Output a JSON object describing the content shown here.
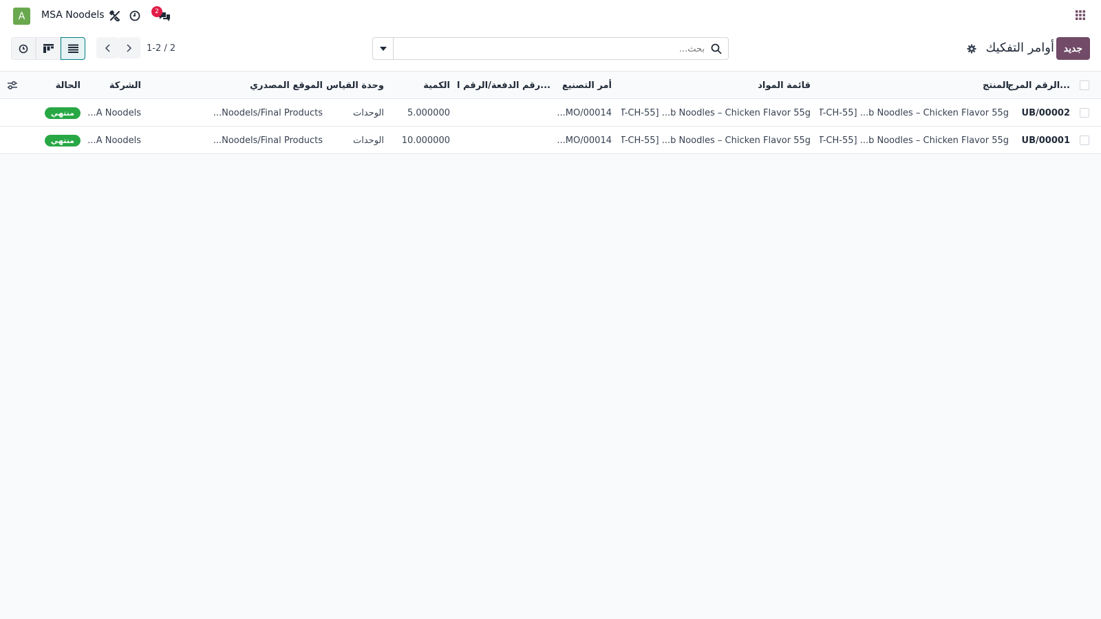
{
  "navbar": {
    "avatar_letter": "A",
    "company": "MSA Noodels",
    "chat_badge": "2",
    "icons": [
      "tools-icon",
      "clock-icon",
      "chat-icon",
      "apps-grid-icon"
    ]
  },
  "control": {
    "new_label": "جديد",
    "title": "أوامر التفكيك",
    "search_placeholder": "بحث...",
    "pager": "1-2 / 2"
  },
  "table": {
    "headers": {
      "ref": "الرقم المرج...",
      "product": "المنتج",
      "bom": "قائمة المواد",
      "mo": "أمر التصنيع",
      "lot": "رقم الدفعة/الرقم التس...",
      "qty": "الكمية",
      "uom": "وحدة القياس",
      "location": "الموقع المصدري",
      "company": "الشركة",
      "state": "الحالة"
    },
    "rows": [
      {
        "ref": "UB/00002",
        "product": "[AT-CH-55] ...b Noodles – Chicken Flavor 55g",
        "bom": "[AT-CH-55] ...b Noodles – Chicken Flavor 55g",
        "mo": "...MO/00014",
        "lot": "",
        "qty": "5.000000",
        "uom": "الوحدات",
        "location": "...Noodels/Final Products",
        "company": "...A Noodels",
        "state": "منتهي"
      },
      {
        "ref": "UB/00001",
        "product": "[AT-CH-55] ...b Noodles – Chicken Flavor 55g",
        "bom": "[AT-CH-55] ...b Noodles – Chicken Flavor 55g",
        "mo": "...MO/00014",
        "lot": "",
        "qty": "10.000000",
        "uom": "الوحدات",
        "location": "...Noodels/Final Products",
        "company": "...A Noodels",
        "state": "منتهي"
      }
    ]
  },
  "colors": {
    "brand": "#714b67",
    "active_view": "#017e84",
    "done": "#28a745",
    "badge": "#e11d48"
  }
}
